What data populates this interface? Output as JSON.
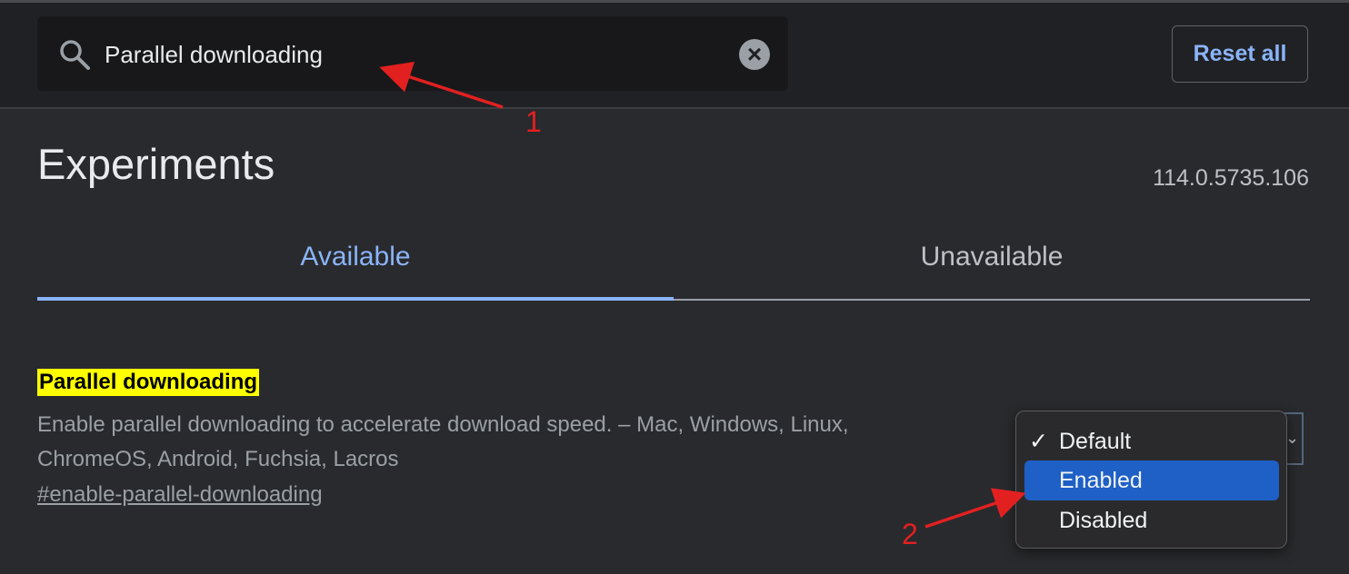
{
  "search": {
    "value": "Parallel downloading",
    "clear_symbol": "×"
  },
  "header": {
    "reset_label": "Reset all"
  },
  "page": {
    "title": "Experiments",
    "version": "114.0.5735.106"
  },
  "tabs": [
    {
      "label": "Available",
      "active": true
    },
    {
      "label": "Unavailable",
      "active": false
    }
  ],
  "flag": {
    "name": "Parallel downloading",
    "description": "Enable parallel downloading to accelerate download speed. – Mac, Windows, Linux, ChromeOS, Android, Fuchsia, Lacros",
    "link": "#enable-parallel-downloading"
  },
  "dropdown": {
    "selected": "Default",
    "highlighted": "Enabled",
    "check_symbol": "✓",
    "options": [
      "Default",
      "Enabled",
      "Disabled"
    ]
  },
  "annotations": {
    "step1": "1",
    "step2": "2",
    "color": "#e32020"
  },
  "colors": {
    "accent": "#8ab4f8",
    "highlight": "#ffff00",
    "selection": "#1e60c6",
    "background": "#292a2d",
    "header": "#202124"
  }
}
